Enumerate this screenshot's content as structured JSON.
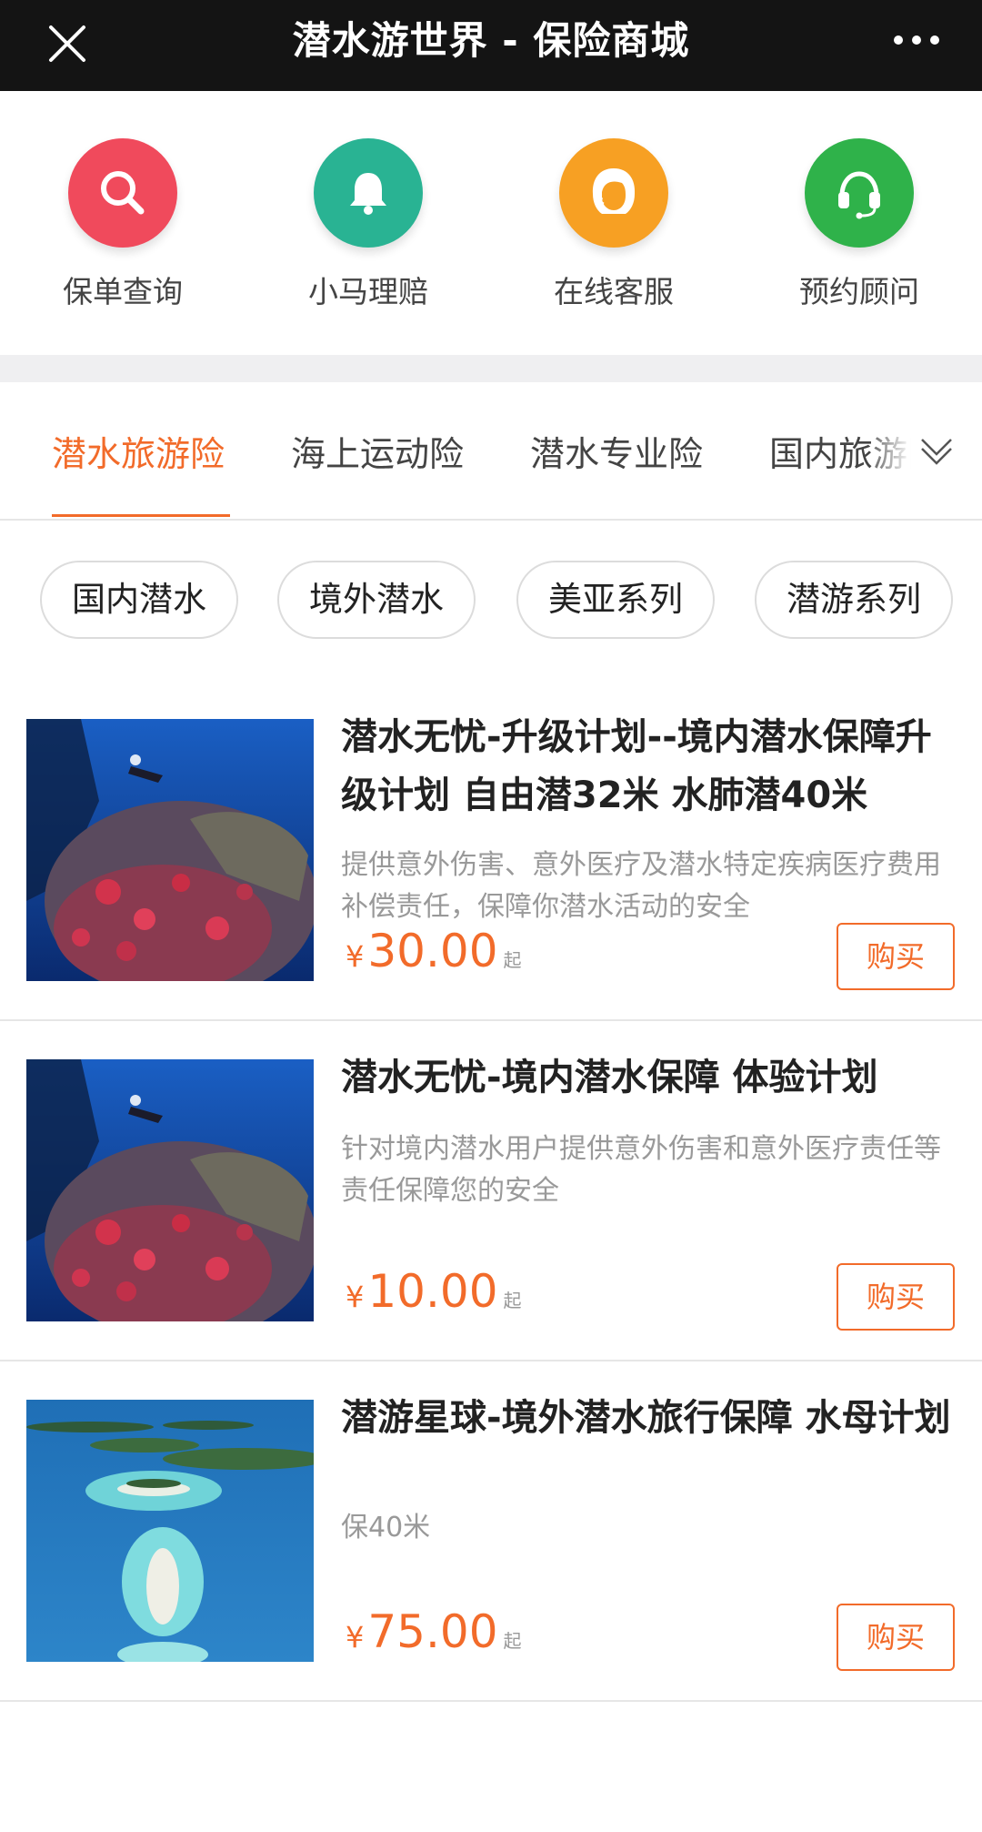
{
  "titlebar": {
    "title": "潜水游世界 - 保险商城",
    "close_icon": "close-icon",
    "more_icon": "more-icon"
  },
  "quick_actions": [
    {
      "label": "保单查询",
      "icon": "search-icon",
      "color": "#f04a5c"
    },
    {
      "label": "小马理赔",
      "icon": "bell-icon",
      "color": "#29b393"
    },
    {
      "label": "在线客服",
      "icon": "customer-service-icon",
      "color": "#f7a023"
    },
    {
      "label": "预约顾问",
      "icon": "headset-icon",
      "color": "#2fb24a"
    }
  ],
  "category_tabs": {
    "items": [
      "潜水旅游险",
      "海上运动险",
      "潜水专业险",
      "国内旅游险"
    ],
    "active": "潜水旅游险",
    "expand_icon": "chevron-down-icon"
  },
  "filter_chips": [
    "国内潜水",
    "境外潜水",
    "美亚系列",
    "潜游系列"
  ],
  "products": [
    {
      "title": "潜水无忧-升级计划--境内潜水保障升级计划 自由潜32米 水肺潜40米",
      "description": "提供意外伤害、意外医疗及潜水特定疾病医疗费用补偿责任，保障你潜水活动的安全",
      "currency": "¥",
      "price": "30.00",
      "price_suffix": "起",
      "buy_label": "购买",
      "image": "coral-reef-diver-photo"
    },
    {
      "title": "潜水无忧-境内潜水保障 体验计划",
      "description": "针对境内潜水用户提供意外伤害和意外医疗责任等责任保障您的安全",
      "currency": "¥",
      "price": "10.00",
      "price_suffix": "起",
      "buy_label": "购买",
      "image": "coral-reef-diver-photo"
    },
    {
      "title": "潜游星球-境外潜水旅行保障 水母计划",
      "description": "保40米",
      "currency": "¥",
      "price": "75.00",
      "price_suffix": "起",
      "buy_label": "购买",
      "image": "island-aerial-photo"
    }
  ],
  "colors": {
    "accent": "#f26b2a",
    "titlebar_bg": "#141414",
    "band_bg": "#efeff1"
  }
}
